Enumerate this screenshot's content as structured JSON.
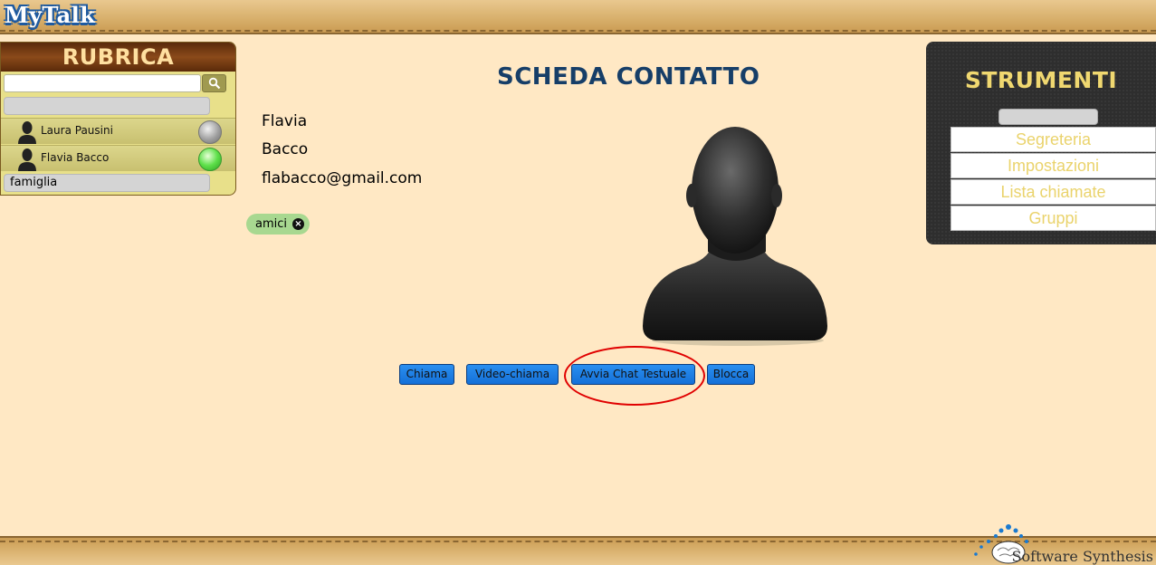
{
  "app": {
    "logo": "MyTalk"
  },
  "rubrica": {
    "title": "RUBRICA",
    "search": {
      "value": "",
      "placeholder": ""
    },
    "contacts": [
      {
        "name": "Laura Pausini",
        "status": "offline"
      },
      {
        "name": "Flavia Bacco",
        "status": "online"
      }
    ],
    "group": "famiglia"
  },
  "main": {
    "title": "SCHEDA CONTATTO",
    "first_name": "Flavia",
    "last_name": "Bacco",
    "email": "flabacco@gmail.com",
    "tags": [
      {
        "label": "amici"
      }
    ],
    "buttons": {
      "call": "Chiama",
      "video_call": "Video-chiama",
      "text_chat": "Avvia Chat Testuale",
      "block": "Blocca"
    }
  },
  "strumenti": {
    "title": "STRUMENTI",
    "items": [
      {
        "label": "Segreteria"
      },
      {
        "label": "Impostazioni"
      },
      {
        "label": "Lista chiamate"
      },
      {
        "label": "Gruppi"
      }
    ]
  },
  "footer": {
    "brand": "Software Synthesis"
  },
  "colors": {
    "background": "#ffe8c4",
    "title": "#163e68",
    "button": "#1e80e6",
    "menu_text": "#ead36c",
    "highlight": "#e00000"
  }
}
